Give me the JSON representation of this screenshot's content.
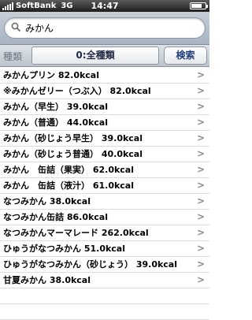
{
  "status": {
    "carrier": "SoftBank",
    "network": "3G",
    "time": "14:47",
    "battery_level": 0.75
  },
  "search": {
    "value": "みかん",
    "placeholder": ""
  },
  "filter": {
    "label": "種類",
    "selected": "0:全種類",
    "search_button": "検索"
  },
  "results": [
    "みかんプリン 82.0kcal",
    "※みかんゼリー（つぶ入） 82.0kcal",
    "みかん（早生） 39.0kcal",
    "みかん（普通） 44.0kcal",
    "みかん（砂じょう早生） 39.0kcal",
    "みかん（砂じょう普通） 40.0kcal",
    "みかん　缶詰（果実） 62.0kcal",
    "みかん　缶詰（液汁） 61.0kcal",
    "なつみかん 38.0kcal",
    "なつみかん缶詰 86.0kcal",
    "なつみかんマーマレード 262.0kcal",
    "ひゅうがなつみかん 51.0kcal",
    "ひゅうがなつみかん（砂じょう） 39.0kcal",
    "甘夏みかん 38.0kcal"
  ],
  "icons": {
    "search": "magnifier-icon",
    "chevron": "chevron-right-icon"
  }
}
